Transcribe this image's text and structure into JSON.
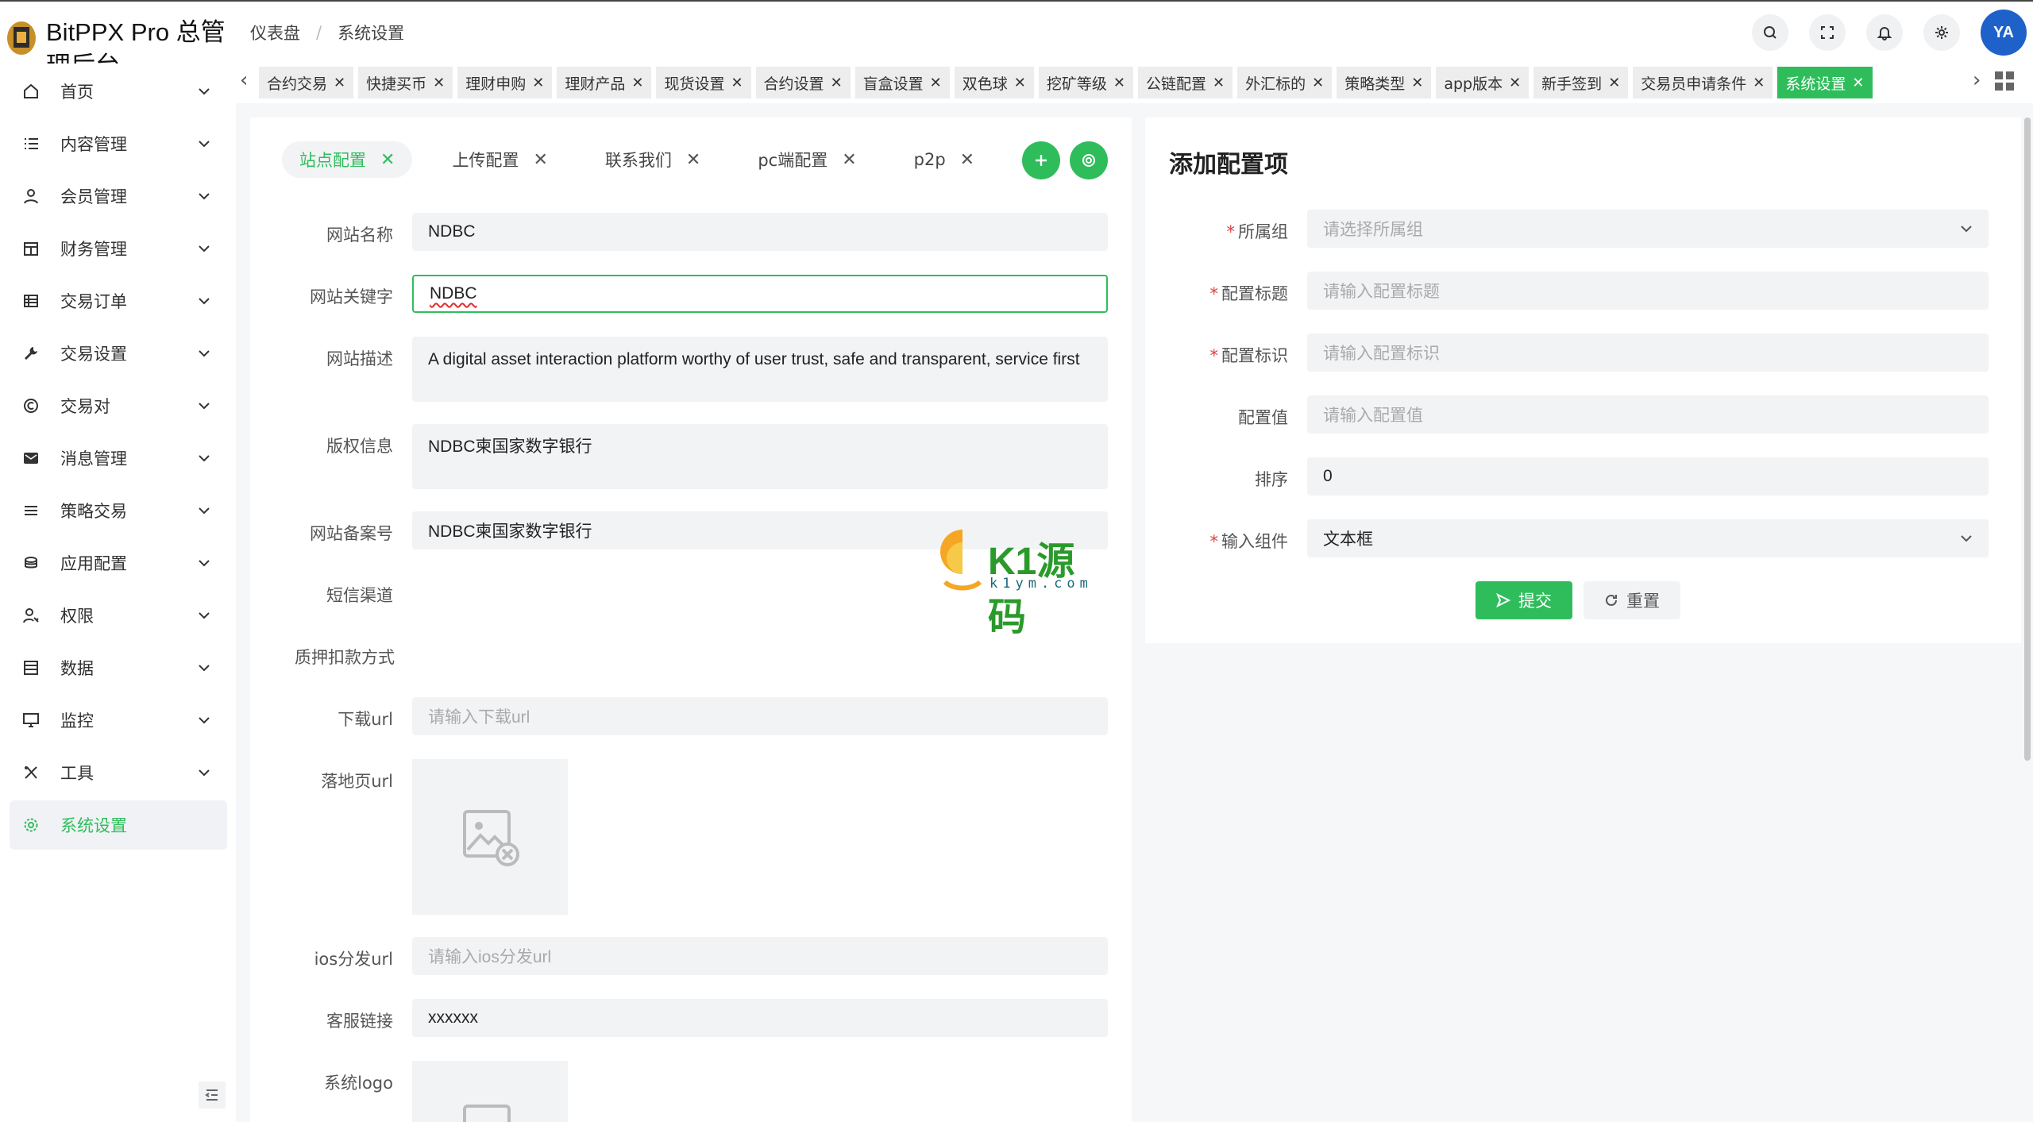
{
  "app": {
    "title": "BitPPX Pro 总管理后台"
  },
  "breadcrumb": [
    "仪表盘",
    "/",
    "系统设置"
  ],
  "avatar_text": "YA",
  "sidebar": {
    "items": [
      {
        "label": "首页",
        "icon": "home-icon"
      },
      {
        "label": "内容管理",
        "icon": "list-icon"
      },
      {
        "label": "会员管理",
        "icon": "user-icon"
      },
      {
        "label": "财务管理",
        "icon": "calendar-icon"
      },
      {
        "label": "交易订单",
        "icon": "table-icon"
      },
      {
        "label": "交易设置",
        "icon": "wrench-icon"
      },
      {
        "label": "交易对",
        "icon": "copyright-icon"
      },
      {
        "label": "消息管理",
        "icon": "message-icon"
      },
      {
        "label": "策略交易",
        "icon": "menu-icon"
      },
      {
        "label": "应用配置",
        "icon": "coin-icon"
      },
      {
        "label": "权限",
        "icon": "user-key-icon"
      },
      {
        "label": "数据",
        "icon": "data-icon"
      },
      {
        "label": "监控",
        "icon": "monitor-icon"
      },
      {
        "label": "工具",
        "icon": "tools-icon"
      },
      {
        "label": "系统设置",
        "icon": "gear-icon"
      }
    ]
  },
  "tabs": [
    "合约交易",
    "快捷买币",
    "理财申购",
    "理财产品",
    "现货设置",
    "合约设置",
    "盲盒设置",
    "双色球",
    "挖矿等级",
    "公链配置",
    "外汇标的",
    "策略类型",
    "app版本",
    "新手签到",
    "交易员申请条件",
    "系统设置"
  ],
  "subtabs": [
    "站点配置",
    "上传配置",
    "联系我们",
    "pc端配置",
    "p2p"
  ],
  "form": {
    "site_name": {
      "label": "网站名称",
      "value": "NDBC"
    },
    "keywords": {
      "label": "网站关键字",
      "value": "NDBC"
    },
    "description": {
      "label": "网站描述",
      "value": "A digital asset interaction platform worthy of user trust, safe and transparent, service first"
    },
    "copyright": {
      "label": "版权信息",
      "value": "NDBC柬国家数字银行"
    },
    "icp": {
      "label": "网站备案号",
      "value": "NDBC柬国家数字银行"
    },
    "sms": {
      "label": "短信渠道"
    },
    "pledge": {
      "label": "质押扣款方式"
    },
    "download_url": {
      "label": "下载url",
      "placeholder": "请输入下载url"
    },
    "landing_url": {
      "label": "落地页url"
    },
    "ios_url": {
      "label": "ios分发url",
      "placeholder": "请输入ios分发url"
    },
    "service_link": {
      "label": "客服链接",
      "value": "xxxxxx"
    },
    "logo": {
      "label": "系统logo"
    }
  },
  "add_config": {
    "title": "添加配置项",
    "group": {
      "label": "所属组",
      "placeholder": "请选择所属组"
    },
    "config_title": {
      "label": "配置标题",
      "placeholder": "请输入配置标题"
    },
    "config_key": {
      "label": "配置标识",
      "placeholder": "请输入配置标识"
    },
    "config_value": {
      "label": "配置值",
      "placeholder": "请输入配置值"
    },
    "sort": {
      "label": "排序",
      "value": "0"
    },
    "input_component": {
      "label": "输入组件",
      "value": "文本框"
    },
    "submit": "提交",
    "reset": "重置"
  },
  "watermark": {
    "main": "K1源码",
    "sub": "k1ym.com"
  },
  "colors": {
    "accent": "#2fbd5c",
    "required": "#e04040"
  }
}
